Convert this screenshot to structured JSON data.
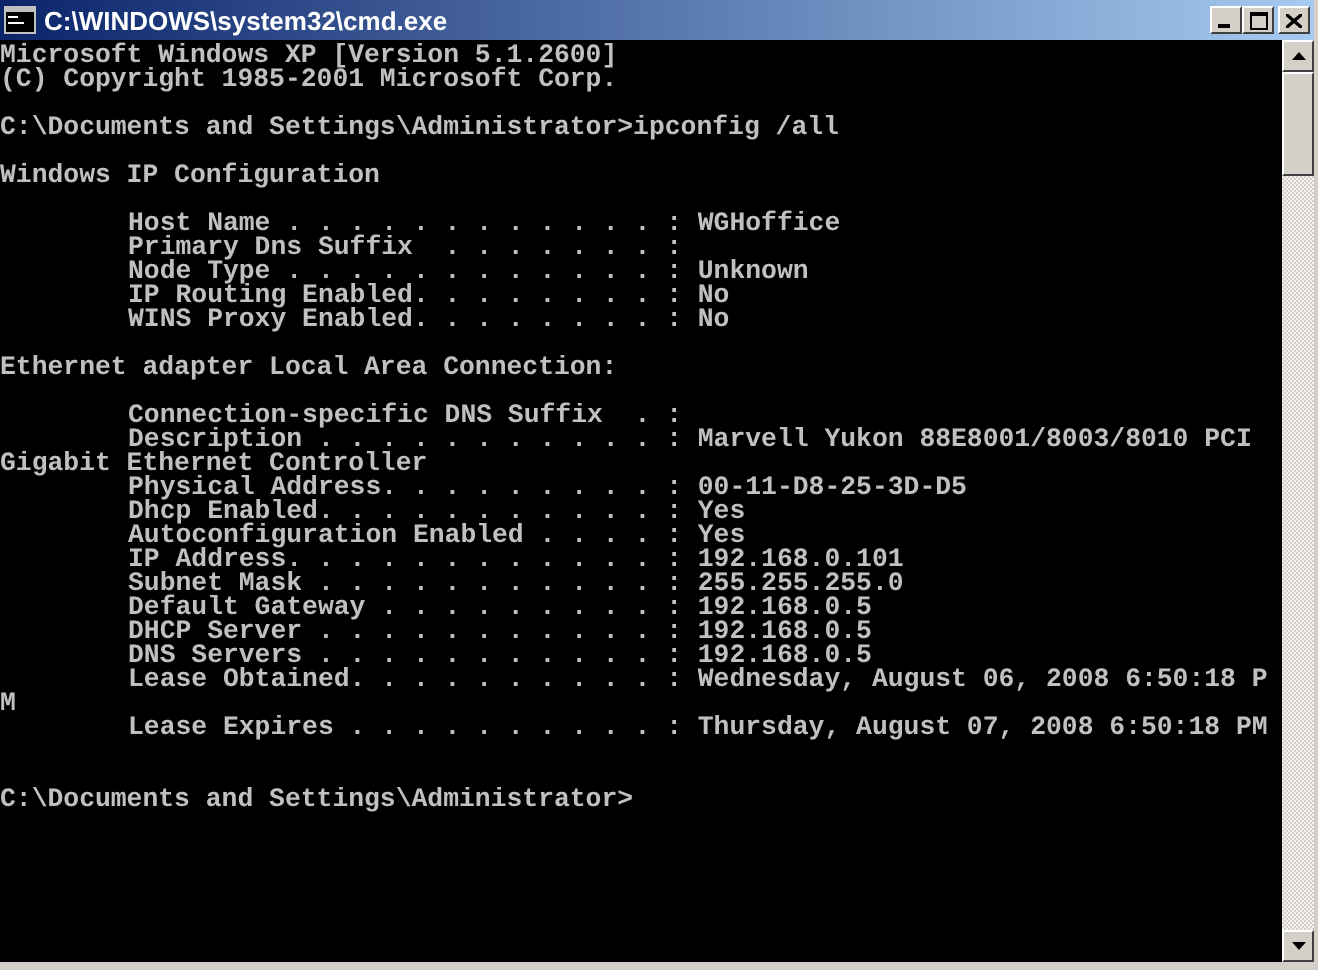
{
  "window": {
    "title": "C:\\WINDOWS\\system32\\cmd.exe"
  },
  "console": {
    "lines": [
      {
        "kind": "text",
        "text": "Microsoft Windows XP [Version 5.1.2600]"
      },
      {
        "kind": "text",
        "text": "(C) Copyright 1985-2001 Microsoft Corp."
      },
      {
        "kind": "blank"
      },
      {
        "kind": "text",
        "text": "C:\\Documents and Settings\\Administrator>ipconfig /all"
      },
      {
        "kind": "blank"
      },
      {
        "kind": "text",
        "text": "Windows IP Configuration"
      },
      {
        "kind": "blank"
      },
      {
        "kind": "indented",
        "text": "Host Name . . . . . . . . . . . . : WGHoffice"
      },
      {
        "kind": "indented",
        "text": "Primary Dns Suffix  . . . . . . . :"
      },
      {
        "kind": "indented",
        "text": "Node Type . . . . . . . . . . . . : Unknown"
      },
      {
        "kind": "indented",
        "text": "IP Routing Enabled. . . . . . . . : No"
      },
      {
        "kind": "indented",
        "text": "WINS Proxy Enabled. . . . . . . . : No"
      },
      {
        "kind": "blank"
      },
      {
        "kind": "text",
        "text": "Ethernet adapter Local Area Connection:"
      },
      {
        "kind": "blank"
      },
      {
        "kind": "indented",
        "text": "Connection-specific DNS Suffix  . :"
      },
      {
        "kind": "indented",
        "text": "Description . . . . . . . . . . . : Marvell Yukon 88E8001/8003/8010 PCI"
      },
      {
        "kind": "text",
        "text": "Gigabit Ethernet Controller"
      },
      {
        "kind": "indented",
        "text": "Physical Address. . . . . . . . . : 00-11-D8-25-3D-D5"
      },
      {
        "kind": "indented",
        "text": "Dhcp Enabled. . . . . . . . . . . : Yes"
      },
      {
        "kind": "indented",
        "text": "Autoconfiguration Enabled . . . . : Yes"
      },
      {
        "kind": "indented",
        "text": "IP Address. . . . . . . . . . . . : 192.168.0.101"
      },
      {
        "kind": "indented",
        "text": "Subnet Mask . . . . . . . . . . . : 255.255.255.0"
      },
      {
        "kind": "indented",
        "text": "Default Gateway . . . . . . . . . : 192.168.0.5"
      },
      {
        "kind": "indented",
        "text": "DHCP Server . . . . . . . . . . . : 192.168.0.5"
      },
      {
        "kind": "indented",
        "text": "DNS Servers . . . . . . . . . . . : 192.168.0.5"
      },
      {
        "kind": "indented",
        "text": "Lease Obtained. . . . . . . . . . : Wednesday, August 06, 2008 6:50:18 P"
      },
      {
        "kind": "text",
        "text": "M"
      },
      {
        "kind": "indented",
        "text": "Lease Expires . . . . . . . . . . : Thursday, August 07, 2008 6:50:18 PM"
      },
      {
        "kind": "blank"
      },
      {
        "kind": "blank"
      },
      {
        "kind": "text",
        "text": "C:\\Documents and Settings\\Administrator>"
      }
    ]
  }
}
